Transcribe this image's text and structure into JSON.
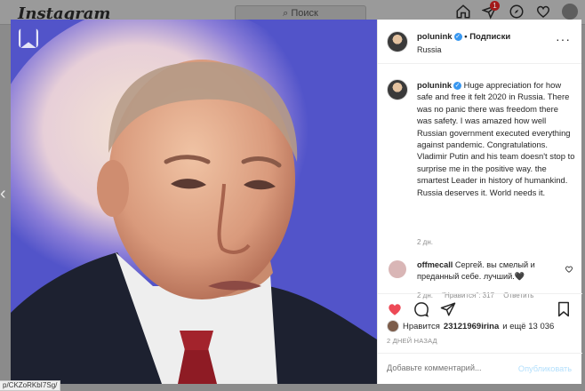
{
  "topbar": {
    "logo": "Instagram",
    "search_placeholder": "Поиск",
    "notifications_count": "1"
  },
  "post": {
    "username": "polunink",
    "follow_label": "Подписки",
    "location": "Russia",
    "caption_username": "polunink",
    "caption_text": "Huge appreciation for how safe and free it felt 2020 in Russia. There was no panic there was freedom there was safety. I was amazed how well Russian government executed everything against pandemic. Congratulations. Vladimir Putin and his team doesn't stop to surprise me in the positive way. the smartest Leader in history of humankind. Russia deserves it. World needs it.",
    "caption_time": "2 дн.",
    "comment": {
      "username": "offmecall",
      "text": "Сергей. вы смелый и преданный себе. лучший.🖤",
      "time": "2 дн.",
      "likes": "\"Нравится\": 317",
      "reply": "Ответить"
    },
    "likes_prefix": "Нравится",
    "likes_user": "23121969irina",
    "likes_suffix": "и ещё 13 036",
    "date": "2 ДНЕЙ НАЗАД",
    "add_comment_placeholder": "Добавьте комментарий...",
    "publish_label": "Опубликовать"
  },
  "status_url": "p/CKZoRKbI7Sg/",
  "icons": {
    "home": "home-icon",
    "direct": "direct-icon",
    "explore": "explore-icon",
    "activity": "heart-icon",
    "bookmark": "bookmark-icon",
    "more": "more-dots-icon",
    "comment": "comment-icon",
    "share": "share-icon"
  },
  "colors": {
    "like_red": "#ed4956",
    "verified_blue": "#3897f0",
    "photo_bg": "#5254c9",
    "publish_disabled": "#b2dffc"
  }
}
